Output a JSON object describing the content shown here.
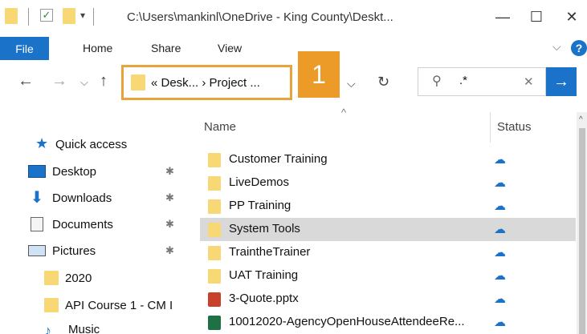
{
  "window": {
    "title": "C:\\Users\\mankinl\\OneDrive - King County\\Deskt...",
    "minimize": "—",
    "maximize": "☐",
    "close": "✕"
  },
  "ribbon": {
    "tabs": [
      "File",
      "Home",
      "Share",
      "View"
    ],
    "expand": "⌵",
    "help": "?"
  },
  "nav": {
    "back": "←",
    "forward": "→",
    "recent": "⌵",
    "up": "↑",
    "breadcrumb": "« Desk... › Project ...",
    "badge": "1",
    "dropdown": "⌵",
    "refresh": "↻",
    "search_icon": "⚲",
    "search_value": ".*",
    "search_clear": "✕",
    "search_go": "→"
  },
  "sidebar": {
    "quick_access": "Quick access",
    "items": [
      {
        "label": "Desktop",
        "pinned": true,
        "icon": "desktop-icon"
      },
      {
        "label": "Downloads",
        "pinned": true,
        "icon": "downloads-icon"
      },
      {
        "label": "Documents",
        "pinned": true,
        "icon": "documents-icon"
      },
      {
        "label": "Pictures",
        "pinned": true,
        "icon": "pictures-icon"
      },
      {
        "label": "2020",
        "pinned": false,
        "icon": "folder-icon"
      },
      {
        "label": "API Course 1 - CM I",
        "pinned": false,
        "icon": "folder-icon"
      },
      {
        "label": "Music",
        "pinned": false,
        "icon": "music-icon"
      }
    ],
    "pin_glyph": "📌"
  },
  "list": {
    "columns": {
      "name": "Name",
      "status": "Status"
    },
    "sort_glyph": "^",
    "status_glyph": "☁",
    "rows": [
      {
        "name": "Customer Training",
        "type": "folder",
        "selected": false
      },
      {
        "name": "LiveDemos",
        "type": "folder",
        "selected": false
      },
      {
        "name": "PP Training",
        "type": "folder",
        "selected": false
      },
      {
        "name": "System Tools",
        "type": "folder",
        "selected": true
      },
      {
        "name": "TraintheTrainer",
        "type": "folder",
        "selected": false
      },
      {
        "name": "UAT Training",
        "type": "folder",
        "selected": false
      },
      {
        "name": "3-Quote.pptx",
        "type": "pptx",
        "selected": false
      },
      {
        "name": "10012020-AgencyOpenHouseAttendeeRe...",
        "type": "xlsx",
        "selected": false
      }
    ]
  },
  "colors": {
    "accent": "#1a73c9",
    "badge": "#ec9a28",
    "highlight_border": "#e8a33a",
    "folder": "#f8d775",
    "selected_row": "#d9d9d9"
  }
}
